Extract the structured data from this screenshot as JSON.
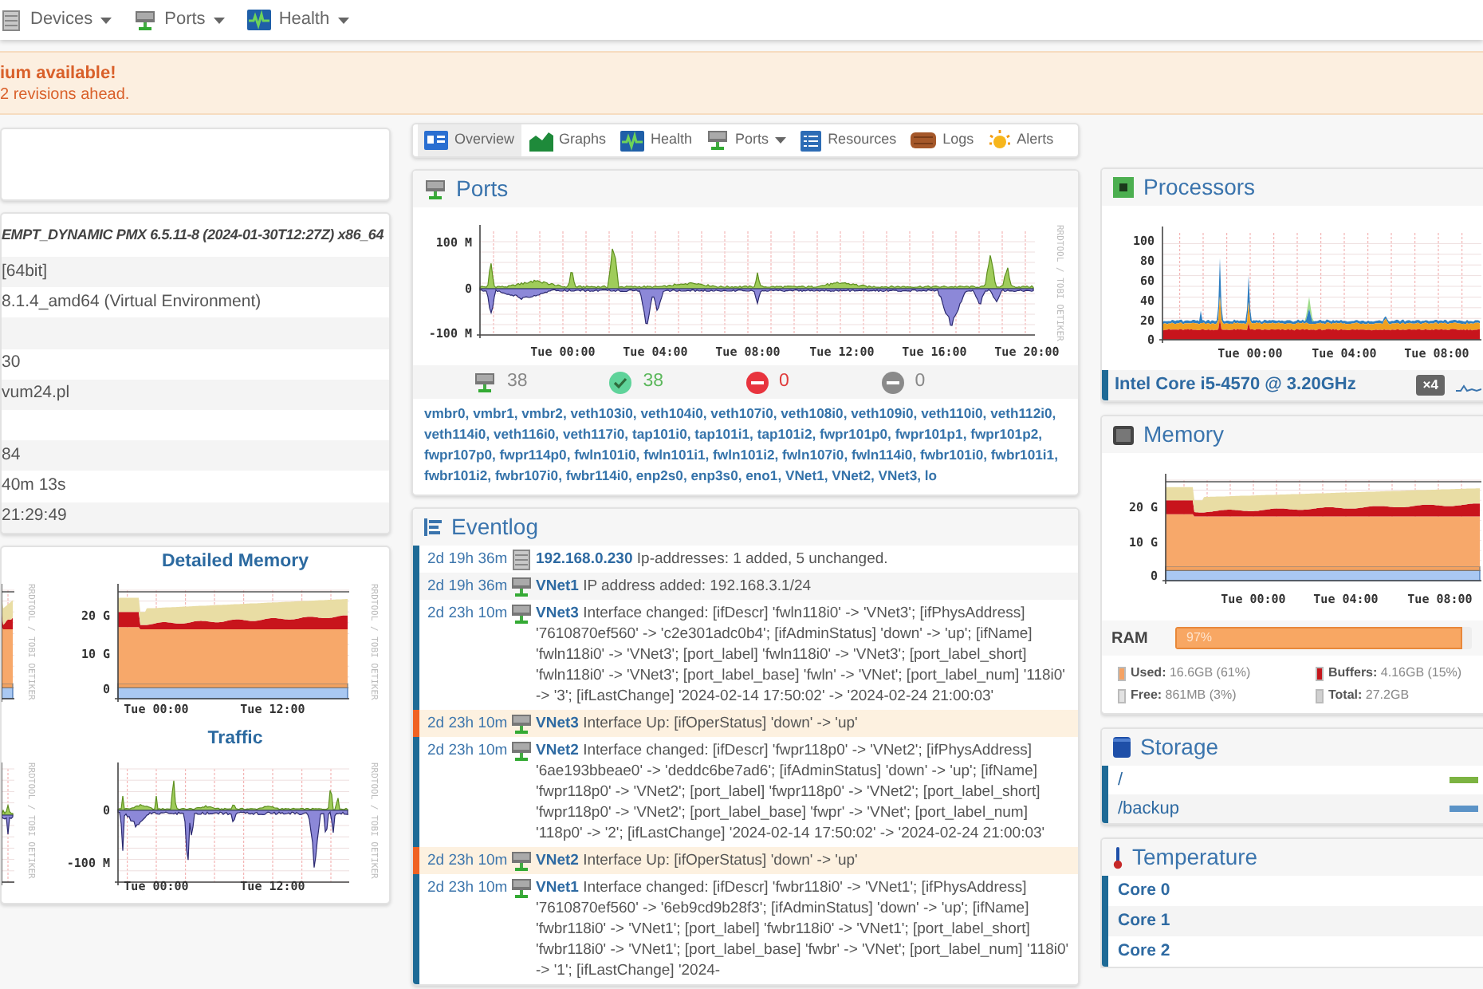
{
  "navbar": {
    "items": [
      {
        "label": "Devices"
      },
      {
        "label": "Ports"
      },
      {
        "label": "Health"
      }
    ]
  },
  "alert": {
    "title": "ium available!",
    "text": "2 revisions ahead."
  },
  "overview": {
    "rows": [
      {
        "kind": "header",
        "text": "EMPT_DYNAMIC PMX 6.5.11-8 (2024-01-30T12:27Z) x86_64"
      },
      {
        "kind": "value",
        "text": "[64bit]"
      },
      {
        "kind": "value",
        "text": "8.1.4_amd64 (Virtual Environment)"
      },
      {
        "kind": "blank"
      },
      {
        "kind": "value",
        "text": "30"
      },
      {
        "kind": "value",
        "text": "vum24.pl"
      },
      {
        "kind": "blank"
      },
      {
        "kind": "value",
        "text": "84"
      },
      {
        "kind": "value",
        "text": "40m 13s"
      },
      {
        "kind": "value",
        "text": "21:29:49"
      }
    ]
  },
  "mini_graphs": [
    {
      "kind": "memory",
      "watermark": "RRDTOOL / TOBI OETIKER"
    },
    {
      "kind": "memory",
      "title": "Detailed Memory",
      "y_labels": [
        "20 G",
        "10 G",
        "0"
      ],
      "x_labels": [
        "Tue 00:00",
        "Tue 12:00"
      ],
      "watermark": "RRDTOOL / TOBI OETIKER"
    },
    {
      "kind": "traffic",
      "watermark": "RRDTOOL / TOBI OETIKER"
    },
    {
      "kind": "traffic",
      "title": "Traffic",
      "y_labels": [
        "0",
        "-100 M"
      ],
      "x_labels": [
        "Tue 00:00",
        "Tue 12:00"
      ],
      "watermark": "RRDTOOL / TOBI OETIKER"
    }
  ],
  "tabs": [
    {
      "label": "Overview",
      "selected": true,
      "dropdown": false
    },
    {
      "label": "Graphs",
      "selected": false,
      "dropdown": false
    },
    {
      "label": "Health",
      "selected": false,
      "dropdown": false
    },
    {
      "label": "Ports",
      "selected": false,
      "dropdown": true
    },
    {
      "label": "Resources",
      "selected": false,
      "dropdown": false
    },
    {
      "label": "Logs",
      "selected": false,
      "dropdown": false
    },
    {
      "label": "Alerts",
      "selected": false,
      "dropdown": false
    }
  ],
  "ports": {
    "title": "Ports",
    "graph": {
      "kind": "traffic",
      "y_labels": [
        "100 M",
        "0",
        "-100 M"
      ],
      "x_labels": [
        "Tue 00:00",
        "Tue 04:00",
        "Tue 08:00",
        "Tue 12:00",
        "Tue 16:00",
        "Tue 20:00"
      ],
      "watermark": "RRDTOOL / TOBI OETIKER"
    },
    "counts": [
      {
        "kind": "total",
        "value": "38"
      },
      {
        "kind": "up",
        "value": "38"
      },
      {
        "kind": "down",
        "value": "0"
      },
      {
        "kind": "disabled",
        "value": "0"
      }
    ],
    "links": [
      "vmbr0,",
      "vmbr1,",
      "vmbr2,",
      "veth103i0,",
      "veth104i0,",
      "veth107i0,",
      "veth108i0,",
      "veth109i0,",
      "veth110i0,",
      "veth112i0,",
      "veth114i0,",
      "veth116i0,",
      "veth117i0,",
      "tap101i0,",
      "tap101i1,",
      "tap101i2,",
      "fwpr101p0,",
      "fwpr101p1,",
      "fwpr101p2,",
      "fwpr107p0,",
      "fwpr114p0,",
      "fwln101i0,",
      "fwln101i1,",
      "fwln101i2,",
      "fwln107i0,",
      "fwln114i0,",
      "fwbr101i0,",
      "fwbr101i1,",
      "fwbr101i2,",
      "fwbr107i0,",
      "fwbr114i0,",
      "enp2s0,",
      "enp3s0,",
      "eno1,",
      "VNet1,",
      "VNet2,",
      "VNet3,",
      "lo"
    ]
  },
  "eventlog": {
    "title": "Eventlog",
    "rows": [
      {
        "time": "2d 19h 36m",
        "kind": "device",
        "highlighted": false,
        "color": "#1e6a96",
        "entity": "192.168.0.230",
        "message": "Ip-addresses: 1 added, 5 unchanged."
      },
      {
        "time": "2d 19h 36m",
        "kind": "port",
        "highlighted": false,
        "color": "#1e6a96",
        "entity": "VNet1",
        "message": "IP address added: 192.168.3.1/24"
      },
      {
        "time": "2d 23h 10m",
        "kind": "port",
        "highlighted": false,
        "color": "#1e6a96",
        "entity": "VNet3",
        "message": "Interface changed: [ifDescr] 'fwln118i0' -> 'VNet3'; [ifPhysAddress] '7610870ef560' -> 'c2e301adc0b4'; [ifAdminStatus] 'down' -> 'up'; [ifName] 'fwln118i0' -> 'VNet3'; [port_label] 'fwln118i0' -> 'VNet3'; [port_label_short] 'fwln118i0' -> 'VNet3'; [port_label_base] 'fwln' -> 'VNet'; [port_label_num] '118i0' -> '3'; [ifLastChange] '2024-02-14 17:50:02' -> '2024-02-24 21:00:03'"
      },
      {
        "time": "2d 23h 10m",
        "kind": "port",
        "highlighted": true,
        "color": "#f06222",
        "entity": "VNet3",
        "message": "Interface Up: [ifOperStatus] 'down' -> 'up'"
      },
      {
        "time": "2d 23h 10m",
        "kind": "port",
        "highlighted": false,
        "color": "#1e6a96",
        "entity": "VNet2",
        "message": "Interface changed: [ifDescr] 'fwpr118p0' -> 'VNet2'; [ifPhysAddress] '6ae193bbeae0' -> 'deddc6be7ad6'; [ifAdminStatus] 'down' -> 'up'; [ifName] 'fwpr118p0' -> 'VNet2'; [port_label] 'fwpr118p0' -> 'VNet2'; [port_label_short] 'fwpr118p0' -> 'VNet2'; [port_label_base] 'fwpr' -> 'VNet'; [port_label_num] '118p0' -> '2'; [ifLastChange] '2024-02-14 17:50:02' -> '2024-02-24 21:00:03'"
      },
      {
        "time": "2d 23h 10m",
        "kind": "port",
        "highlighted": true,
        "color": "#f06222",
        "entity": "VNet2",
        "message": "Interface Up: [ifOperStatus] 'down' -> 'up'"
      },
      {
        "time": "2d 23h 10m",
        "kind": "port",
        "highlighted": false,
        "color": "#1e6a96",
        "entity": "VNet1",
        "message": "Interface changed: [ifDescr] 'fwbr118i0' -> 'VNet1'; [ifPhysAddress] '7610870ef560' -> '6eb9cd9b28f3'; [ifAdminStatus] 'down' -> 'up'; [ifName] 'fwbr118i0' -> 'VNet1'; [port_label] 'fwbr118i0' -> 'VNet1'; [port_label_short] 'fwbr118i0' -> 'VNet1'; [port_label_base] 'fwbr' -> 'VNet'; [port_label_num] '118i0' -> '1'; [ifLastChange] '2024-"
      }
    ]
  },
  "processors": {
    "title": "Processors",
    "graph": {
      "kind": "cpu",
      "y_labels": [
        "100",
        "80",
        "60",
        "40",
        "20",
        "0"
      ],
      "x_labels": [
        "Tue 00:00",
        "Tue 04:00",
        "Tue 08:00"
      ]
    },
    "name": "Intel Core i5-4570 @ 3.20GHz",
    "count": "×4"
  },
  "memory": {
    "title": "Memory",
    "graph": {
      "kind": "memory",
      "y_labels": [
        "20 G",
        "10 G",
        "0"
      ],
      "x_labels": [
        "Tue 00:00",
        "Tue 04:00",
        "Tue 08:00"
      ]
    },
    "ram": {
      "label": "RAM",
      "level": 0.97,
      "reading": "97%"
    },
    "legend": [
      {
        "label": "Used:",
        "value": "16.6GB (61%)",
        "color": "#f5a263"
      },
      {
        "label": "Buffers:",
        "value": "4.16GB (15%)",
        "color": "#c4161c"
      },
      {
        "label": "Free:",
        "value": "861MB (3%)",
        "color": "#e2e2e2"
      },
      {
        "label": "Total:",
        "value": "27.2GB",
        "color": "#d0d0d0"
      }
    ]
  },
  "storage": {
    "title": "Storage",
    "rows": [
      {
        "name": "/",
        "color": "#7cb342"
      },
      {
        "name": "/backup",
        "color": "#5b93c7"
      }
    ]
  },
  "temperature": {
    "title": "Temperature",
    "rows": [
      {
        "name": "Core 0"
      },
      {
        "name": "Core 1"
      },
      {
        "name": "Core 2"
      }
    ]
  }
}
